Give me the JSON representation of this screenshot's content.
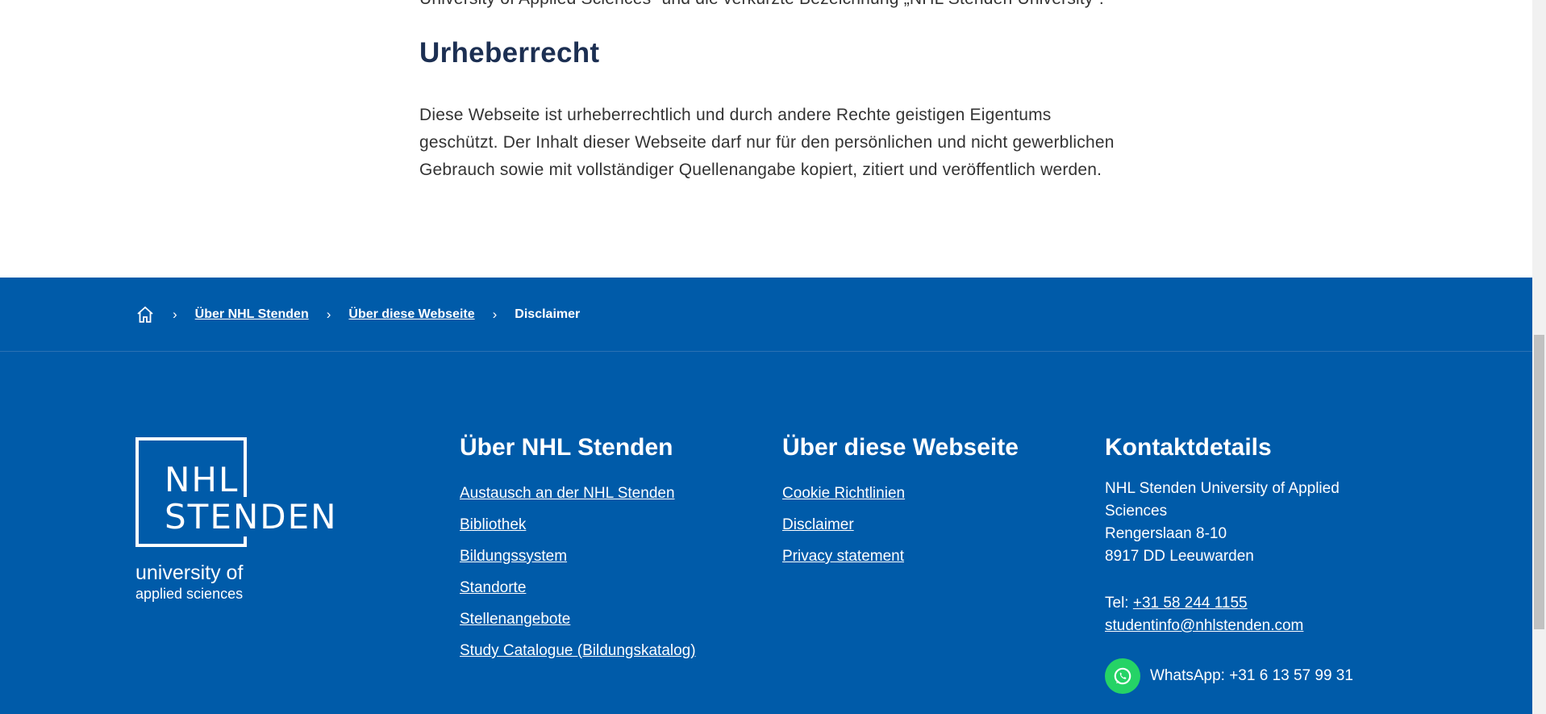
{
  "article": {
    "intro_text": "University of Applied Sciences“ und die verkürzte Bezeichnung „NHL Stenden University“.",
    "heading": "Urheberrecht",
    "body": "Diese Webseite ist urheberrechtlich und durch andere Rechte geistigen Eigentums geschützt. Der Inhalt dieser Webseite darf nur für den persönlichen und nicht gewerblichen Gebrauch sowie mit vollständiger Quellenangabe kopiert, zitiert und veröffentlich werden."
  },
  "breadcrumb": {
    "home_icon": "home-icon",
    "items": [
      "Über NHL Stenden",
      "Über diese Webseite",
      "Disclaimer"
    ],
    "separator": "›"
  },
  "logo": {
    "line1": "NHL",
    "line2": "STENDEN",
    "sub1": "university of",
    "sub2": "applied sciences"
  },
  "footer": {
    "col1": {
      "title": "Über NHL Stenden",
      "links": [
        "Austausch an der NHL Stenden",
        "Bibliothek",
        "Bildungssystem",
        "Standorte",
        "Stellenangebote",
        "Study Catalogue (Bildungskatalog)"
      ]
    },
    "col2": {
      "title": "Über diese Webseite",
      "links": [
        "Cookie Richtlinien",
        "Disclaimer",
        "Privacy statement"
      ]
    },
    "contact": {
      "title": "Kontaktdetails",
      "name": "NHL Stenden University of Applied Sciences",
      "street": "Rengerslaan 8-10",
      "city": "8917 DD Leeuwarden",
      "tel_label": "Tel: ",
      "tel": "+31 58 244 1155",
      "email": "studentinfo@nhlstenden.com",
      "whatsapp": "WhatsApp: +31 6 13 57 99 31",
      "whatsapp_icon": "whatsapp-icon"
    }
  },
  "colors": {
    "footer_bg": "#005ba9",
    "heading": "#1c2f52",
    "whatsapp": "#25d366"
  }
}
